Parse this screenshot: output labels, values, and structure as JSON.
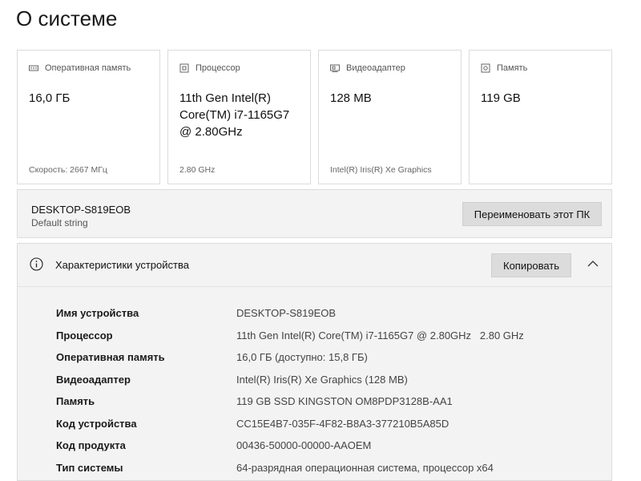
{
  "page": {
    "title": "О системе"
  },
  "cards": [
    {
      "icon": "memory-icon",
      "label": "Оперативная память",
      "value": "16,0 ГБ",
      "sub": "Скорость: 2667 МГц"
    },
    {
      "icon": "processor-icon",
      "label": "Процессор",
      "value": "11th Gen Intel(R) Core(TM) i7-1165G7 @ 2.80GHz",
      "sub": "2.80 GHz"
    },
    {
      "icon": "display-adapter-icon",
      "label": "Видеоадаптер",
      "value": "128 MB",
      "sub": "Intel(R) Iris(R) Xe Graphics"
    },
    {
      "icon": "storage-icon",
      "label": "Память",
      "value": "119 GB",
      "sub": ""
    }
  ],
  "device": {
    "name": "DESKTOP-S819EOB",
    "subtitle": "Default string",
    "rename_label": "Переименовать этот ПК"
  },
  "specs": {
    "title": "Характеристики устройства",
    "copy_label": "Копировать",
    "rows": [
      {
        "key": "Имя устройства",
        "value": "DESKTOP-S819EOB"
      },
      {
        "key": "Процессор",
        "value": "11th Gen Intel(R) Core(TM) i7-1165G7 @ 2.80GHz   2.80 GHz"
      },
      {
        "key": "Оперативная память",
        "value": "16,0 ГБ (доступно: 15,8 ГБ)"
      },
      {
        "key": "Видеоадаптер",
        "value": "Intel(R) Iris(R) Xe Graphics (128 MB)"
      },
      {
        "key": "Память",
        "value": "119 GB SSD KINGSTON OM8PDP3128B-AA1"
      },
      {
        "key": "Код устройства",
        "value": "CC15E4B7-035F-4F82-B8A3-377210B5A85D"
      },
      {
        "key": "Код продукта",
        "value": "00436-50000-00000-AAOEM"
      },
      {
        "key": "Тип системы",
        "value": "64-разрядная операционная система, процессор x64"
      }
    ]
  }
}
